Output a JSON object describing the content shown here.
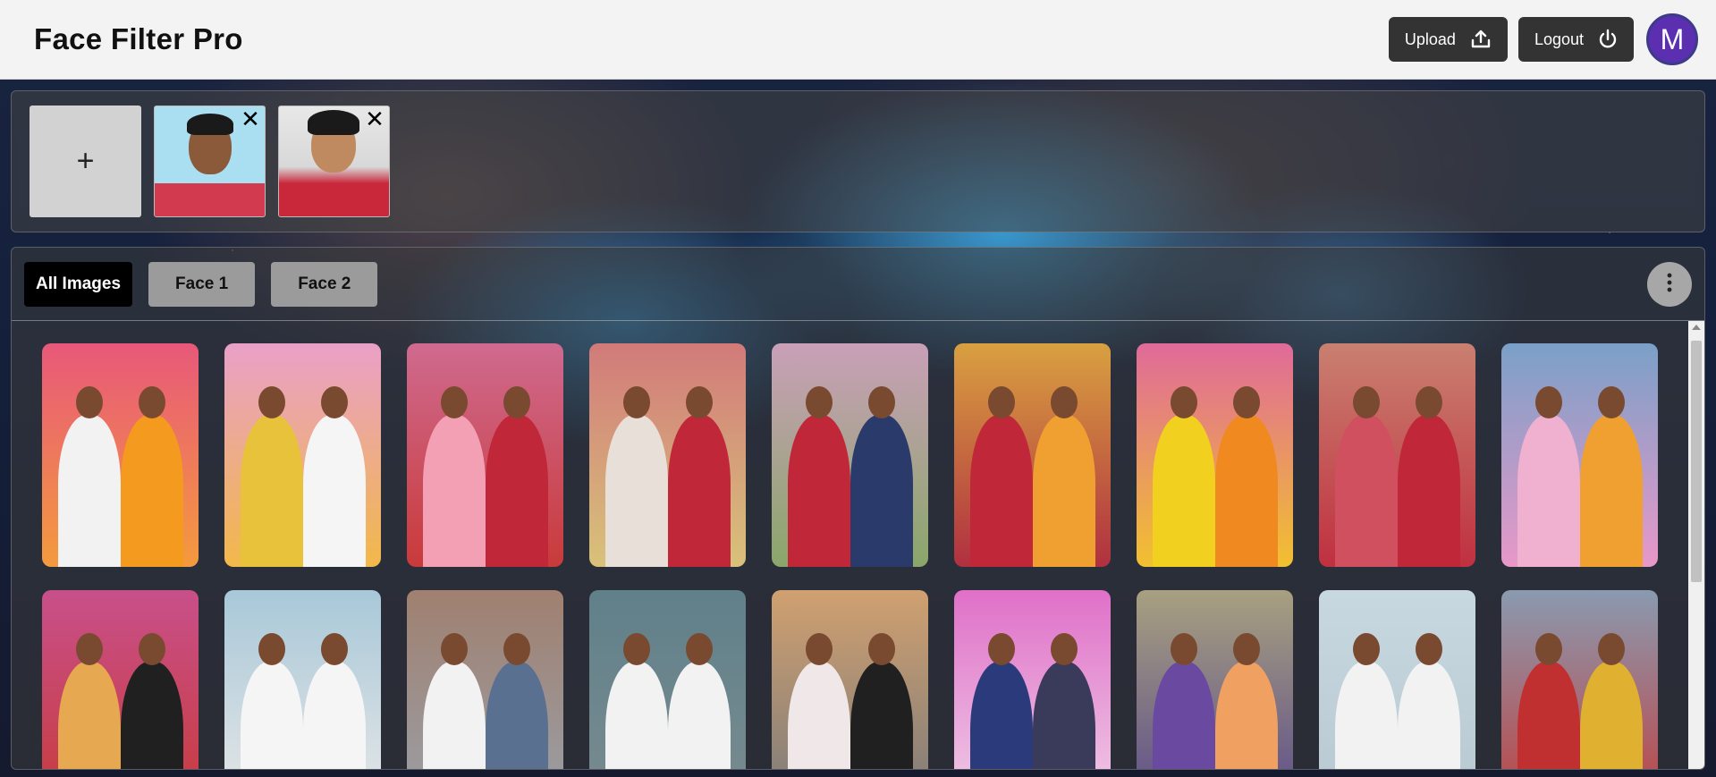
{
  "header": {
    "title": "Face Filter Pro",
    "upload_label": "Upload",
    "logout_label": "Logout",
    "avatar_initial": "M"
  },
  "faces": {
    "add_label": "+",
    "items": [
      {
        "id": "Face 1",
        "remove": "✕"
      },
      {
        "id": "Face 2",
        "remove": "✕"
      }
    ]
  },
  "tabs": [
    {
      "label": "All Images",
      "active": true
    },
    {
      "label": "Face 1",
      "active": false
    },
    {
      "label": "Face 2",
      "active": false
    }
  ],
  "photos": [
    {
      "bg": "#e8587a",
      "bg2": "#f49a3e",
      "fg": [
        "#f2f2f2",
        "#f39a1f"
      ]
    },
    {
      "bg": "#e9a0c8",
      "bg2": "#f2b84a",
      "fg": [
        "#e8c23a",
        "#f5f5f5"
      ]
    },
    {
      "bg": "#cf6a8f",
      "bg2": "#c93a3a",
      "fg": [
        "#f3a0b4",
        "#c0283a"
      ]
    },
    {
      "bg": "#d27a7a",
      "bg2": "#d8c27a",
      "fg": [
        "#e8e0d8",
        "#c0283a"
      ]
    },
    {
      "bg": "#c9a0b8",
      "bg2": "#8aa66a",
      "fg": [
        "#c0283a",
        "#2a3a6a"
      ]
    },
    {
      "bg": "#d9a040",
      "bg2": "#b03040",
      "fg": [
        "#c0283a",
        "#f0a030"
      ]
    },
    {
      "bg": "#e06a9a",
      "bg2": "#f2c030",
      "fg": [
        "#f2d020",
        "#f08a20"
      ]
    },
    {
      "bg": "#c98070",
      "bg2": "#c03040",
      "fg": [
        "#d05060",
        "#c0283a"
      ]
    },
    {
      "bg": "#7aa0c8",
      "bg2": "#e898c8",
      "fg": [
        "#f0b0d0",
        "#f0a030"
      ]
    },
    {
      "bg": "#c8508a",
      "bg2": "#c83a3a",
      "fg": [
        "#e6a850",
        "#202020"
      ]
    },
    {
      "bg": "#a8c8d8",
      "bg2": "#e8e8e8",
      "fg": [
        "#f5f5f5",
        "#f5f5f5"
      ]
    },
    {
      "bg": "#a08070",
      "bg2": "#9aa0a8",
      "fg": [
        "#f2f2f2",
        "#5a7090"
      ]
    },
    {
      "bg": "#60808a",
      "bg2": "#7a8c90",
      "fg": [
        "#f2f2f2",
        "#f2f2f2"
      ]
    },
    {
      "bg": "#d0a070",
      "bg2": "#7a7a7a",
      "fg": [
        "#f0e8e8",
        "#202020"
      ]
    },
    {
      "bg": "#e070c8",
      "bg2": "#f0d0e8",
      "fg": [
        "#2a3a7a",
        "#3a3a5a"
      ]
    },
    {
      "bg": "#a8a080",
      "bg2": "#5a4a8a",
      "fg": [
        "#6a4aa0",
        "#f0a060"
      ]
    },
    {
      "bg": "#c8d8e0",
      "bg2": "#b8c8d0",
      "fg": [
        "#f2f2f2",
        "#f2f2f2"
      ]
    },
    {
      "bg": "#8a9ab0",
      "bg2": "#c04040",
      "fg": [
        "#c03030",
        "#e0b030"
      ]
    }
  ]
}
